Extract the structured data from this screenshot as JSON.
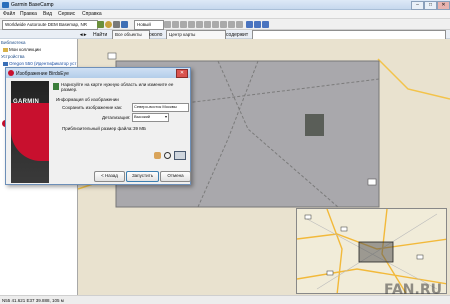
{
  "window": {
    "title": "Garmin BaseCamp",
    "controls": [
      "–",
      "□",
      "✕"
    ]
  },
  "menu": [
    "Файл",
    "Правка",
    "Вид",
    "Сервис",
    "Справка"
  ],
  "toolbar": {
    "map_product": "Worldwide Autoroute DEM Basemap, NR",
    "new_label": "Новый"
  },
  "search": {
    "find_label": "Найти",
    "all_objects": "Все объекты",
    "near_label": "около",
    "map_center": "Центр карты",
    "contains_label": "содержит"
  },
  "sidebar": {
    "library_header": "Библиотека",
    "my_collection": "Мои коллекции",
    "devices_header": "Устройства",
    "device_name": "Oregon 550 (Идентификатор уст",
    "all_data": "Все данные"
  },
  "dialog": {
    "title": "Изображение BirdsEye",
    "brand_logo": "GARMIN",
    "instruction": "Нарисуйте на карте нужную область или измените ее размер.",
    "info_header": "Информация об изображении",
    "save_label": "Сохранить изображение как:",
    "save_value": "Северо-восток Москвы",
    "detail_label": "Детализация:",
    "detail_value": "Высокий",
    "size_label": "Приблизительный размер файла:",
    "size_value": "39 МБ",
    "back_button": "< Назад",
    "start_button": "Запустить",
    "cancel_button": "Отмена"
  },
  "statusbar": {
    "coords": "N55 41.621 E37 39.888, 105 м"
  },
  "watermark": "FAN.RU",
  "colors": {
    "title_bar": "#c6d8ee",
    "map_bg": "#e9e2cf",
    "selection": "#8a8a8a",
    "garmin_red": "#c8102e"
  }
}
